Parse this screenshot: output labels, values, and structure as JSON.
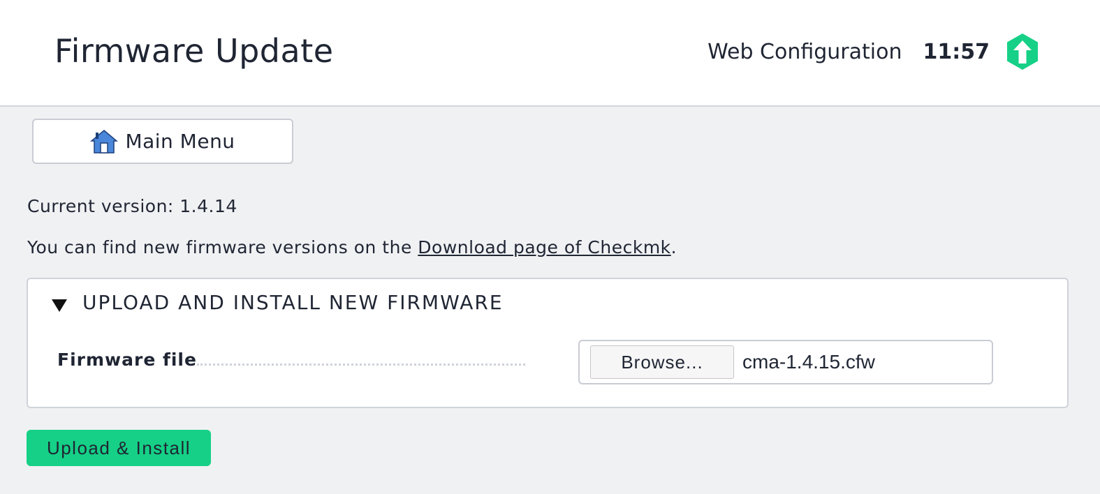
{
  "header": {
    "title": "Firmware Update",
    "app_name": "Web Configuration",
    "time": "11:57",
    "logo_icon": "checkmk-logo-icon",
    "logo_color": "#15d086"
  },
  "nav": {
    "main_menu_label": "Main Menu",
    "main_menu_icon": "home-icon"
  },
  "content": {
    "current_version": "Current version: 1.4.14",
    "info_prefix": "You can find new firmware versions on the ",
    "info_link": "Download page of Checkmk",
    "info_suffix": "."
  },
  "section": {
    "title": "UPLOAD AND INSTALL NEW FIRMWARE",
    "toggle_icon": "triangle-down-icon",
    "field_label": "Firmware file",
    "browse_label": "Browse...",
    "file_name": "cma-1.4.15.cfw"
  },
  "actions": {
    "submit_label": "Upload & Install",
    "submit_color": "#15d086"
  }
}
